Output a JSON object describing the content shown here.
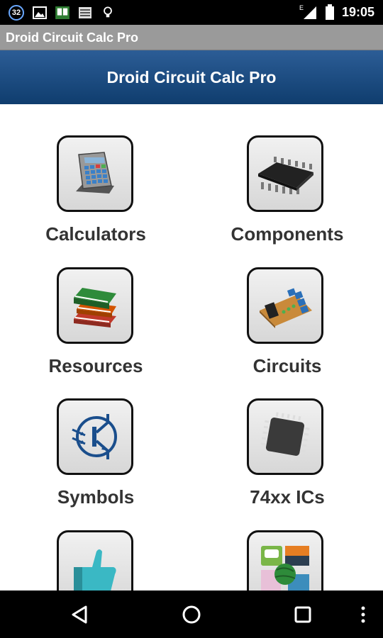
{
  "status_bar": {
    "notification_count": "32",
    "network": "E",
    "time": "19:05",
    "icons": [
      "image-icon",
      "book-app-icon",
      "newspaper-icon",
      "lightbulb-icon",
      "signal-icon",
      "battery-icon"
    ]
  },
  "app_bar": {
    "title": "Droid Circuit Calc Pro"
  },
  "header": {
    "title": "Droid Circuit Calc Pro"
  },
  "menu": {
    "items": [
      {
        "label": "Calculators",
        "icon": "calculator-icon"
      },
      {
        "label": "Components",
        "icon": "chip-icon"
      },
      {
        "label": "Resources",
        "icon": "books-icon"
      },
      {
        "label": "Circuits",
        "icon": "circuit-board-icon"
      },
      {
        "label": "Symbols",
        "icon": "transistor-symbol-icon"
      },
      {
        "label": "74xx ICs",
        "icon": "ic-package-icon"
      },
      {
        "label": "",
        "icon": "thumbs-up-icon"
      },
      {
        "label": "",
        "icon": "apps-icon"
      }
    ]
  },
  "navigation": {
    "buttons": [
      "back",
      "home",
      "recents",
      "menu"
    ]
  },
  "colors": {
    "header_top": "#2c5d96",
    "header_bottom": "#0f3d6e",
    "title_bar": "#9a9a9a"
  }
}
